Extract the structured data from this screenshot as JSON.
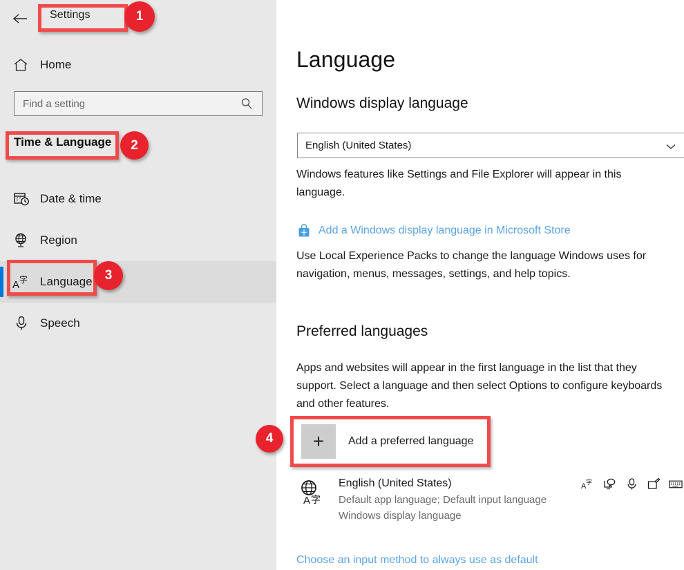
{
  "window": {
    "title": "Settings",
    "back_icon": "back-arrow-icon"
  },
  "sidebar": {
    "home": {
      "label": "Home",
      "icon": "home-icon"
    },
    "search": {
      "value": "",
      "placeholder": "Find a setting",
      "icon": "search-icon"
    },
    "section_header": "Time & Language",
    "items": [
      {
        "label": "Date & time",
        "icon": "calendar-clock-icon",
        "selected": false
      },
      {
        "label": "Region",
        "icon": "globe-stand-icon",
        "selected": false
      },
      {
        "label": "Language",
        "icon": "language-a-character-icon",
        "selected": true
      },
      {
        "label": "Speech",
        "icon": "microphone-icon",
        "selected": false
      }
    ]
  },
  "main": {
    "page_title": "Language",
    "display_language": {
      "heading": "Windows display language",
      "selected_value": "English (United States)",
      "chevron_icon": "chevron-down-icon",
      "description": "Windows features like Settings and File Explorer will appear in this language.",
      "store_link": "Add a Windows display language in Microsoft Store",
      "store_icon": "microsoft-store-bag-icon",
      "lep_description": "Use Local Experience Packs to change the language Windows uses for navigation, menus, messages, settings, and help topics."
    },
    "preferred_languages": {
      "heading": "Preferred languages",
      "description": "Apps and websites will appear in the first language in the list that they support. Select a language and then select Options to configure keyboards and other features.",
      "add_button": {
        "label": "Add a preferred language",
        "icon": "plus-icon"
      },
      "entries": [
        {
          "icon": "globe-language-icon",
          "name": "English (United States)",
          "sub1": "Default app language; Default input language",
          "sub2": "Windows display language",
          "feature_icons": [
            "language-pack-icon",
            "display-language-icon",
            "speech-microphone-icon",
            "handwriting-pen-icon",
            "keyboard-icon"
          ]
        }
      ],
      "bottom_link": "Choose an input method to always use as default"
    }
  },
  "annotations": {
    "highlight_color": "#f04b4b",
    "badge_color": "#e9232d",
    "callouts": [
      {
        "number": "1",
        "target": "settings-title"
      },
      {
        "number": "2",
        "target": "time-and-language-header"
      },
      {
        "number": "3",
        "target": "sidebar-item-language"
      },
      {
        "number": "4",
        "target": "add-preferred-language-button"
      }
    ]
  }
}
